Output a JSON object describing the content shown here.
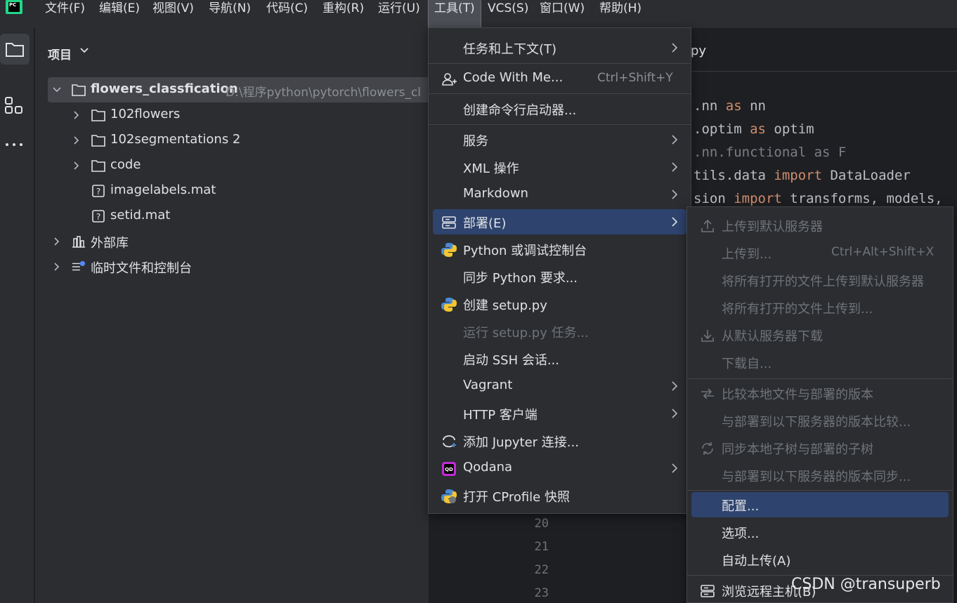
{
  "menubar": {
    "items": [
      "文件(F)",
      "编辑(E)",
      "视图(V)",
      "导航(N)",
      "代码(C)",
      "重构(R)",
      "运行(U)",
      "工具(T)",
      "VCS(S)",
      "窗口(W)",
      "帮助(H)"
    ],
    "active_index": 7,
    "logo_text": "PC"
  },
  "project": {
    "title": "项目",
    "tree": [
      {
        "label": "flowers_classfication",
        "path": "D:\\程序python\\pytorch\\flowers_cl",
        "type": "folder",
        "expanded": true
      },
      {
        "label": "102flowers",
        "type": "folder"
      },
      {
        "label": "102segmentations 2",
        "type": "folder"
      },
      {
        "label": "code",
        "type": "folder"
      },
      {
        "label": "imagelabels.mat",
        "type": "unknown-file"
      },
      {
        "label": "setid.mat",
        "type": "unknown-file"
      },
      {
        "label": "外部库",
        "type": "library"
      },
      {
        "label": "临时文件和控制台",
        "type": "scratches"
      }
    ]
  },
  "editor": {
    "tab_fragment": "py",
    "code": [
      {
        "a": ".nn ",
        "b": "as",
        "c": " nn"
      },
      {
        "a": ".optim ",
        "b": "as",
        "c": " optim"
      },
      {
        "a": ".nn.functional as F",
        "b": "",
        "c": ""
      },
      {
        "a": "tils.data ",
        "b": "import",
        "c": " DataLoader"
      },
      {
        "a": "sion ",
        "b": "import",
        "c": " transforms, models,"
      }
    ],
    "line_numbers": [
      "20",
      "21",
      "22",
      "23"
    ]
  },
  "tools_menu": {
    "items": [
      {
        "label": "任务和上下文(T)",
        "submenu": true
      },
      {
        "label": "Code With Me...",
        "shortcut": "Ctrl+Shift+Y",
        "icon": "person-add-icon"
      },
      {
        "label": "创建命令行启动器..."
      },
      {
        "label": "服务",
        "submenu": true
      },
      {
        "label": "XML 操作",
        "submenu": true
      },
      {
        "label": "Markdown",
        "submenu": true
      },
      {
        "label": "部署(E)",
        "submenu": true,
        "icon": "server-icon",
        "highlighted": true
      },
      {
        "label": "Python 或调试控制台",
        "icon": "python-icon"
      },
      {
        "label": "同步 Python 要求..."
      },
      {
        "label": "创建 setup.py",
        "icon": "python-icon"
      },
      {
        "label": "运行 setup.py 任务...",
        "disabled": true
      },
      {
        "label": "启动 SSH 会话..."
      },
      {
        "label": "Vagrant",
        "submenu": true
      },
      {
        "label": "HTTP 客户端",
        "submenu": true
      },
      {
        "label": "添加 Jupyter 连接...",
        "icon": "jupyter-icon"
      },
      {
        "label": "Qodana",
        "submenu": true,
        "icon": "qodana-icon"
      },
      {
        "label": "打开 CProfile 快照",
        "icon": "profiler-icon"
      }
    ]
  },
  "deploy_menu": {
    "items": [
      {
        "label": "上传到默认服务器",
        "disabled": true,
        "icon": "upload-icon"
      },
      {
        "label": "上传到...",
        "shortcut": "Ctrl+Alt+Shift+X",
        "disabled": true
      },
      {
        "label": "将所有打开的文件上传到默认服务器",
        "disabled": true
      },
      {
        "label": "将所有打开的文件上传到...",
        "disabled": true
      },
      {
        "label": "从默认服务器下载",
        "disabled": true,
        "icon": "download-icon"
      },
      {
        "label": "下载自...",
        "disabled": true
      },
      {
        "label": "比较本地文件与部署的版本",
        "disabled": true,
        "icon": "compare-icon"
      },
      {
        "label": "与部署到以下服务器的版本比较...",
        "disabled": true
      },
      {
        "label": "同步本地子树与部署的子树",
        "disabled": true,
        "icon": "sync-icon"
      },
      {
        "label": "与部署到以下服务器的版本同步...",
        "disabled": true
      },
      {
        "label": "配置...",
        "highlighted": true
      },
      {
        "label": "选项..."
      },
      {
        "label": "自动上传(A)"
      },
      {
        "label": "浏览远程主机(B)",
        "icon": "server-icon"
      }
    ]
  },
  "watermark": "CSDN @transuperb"
}
